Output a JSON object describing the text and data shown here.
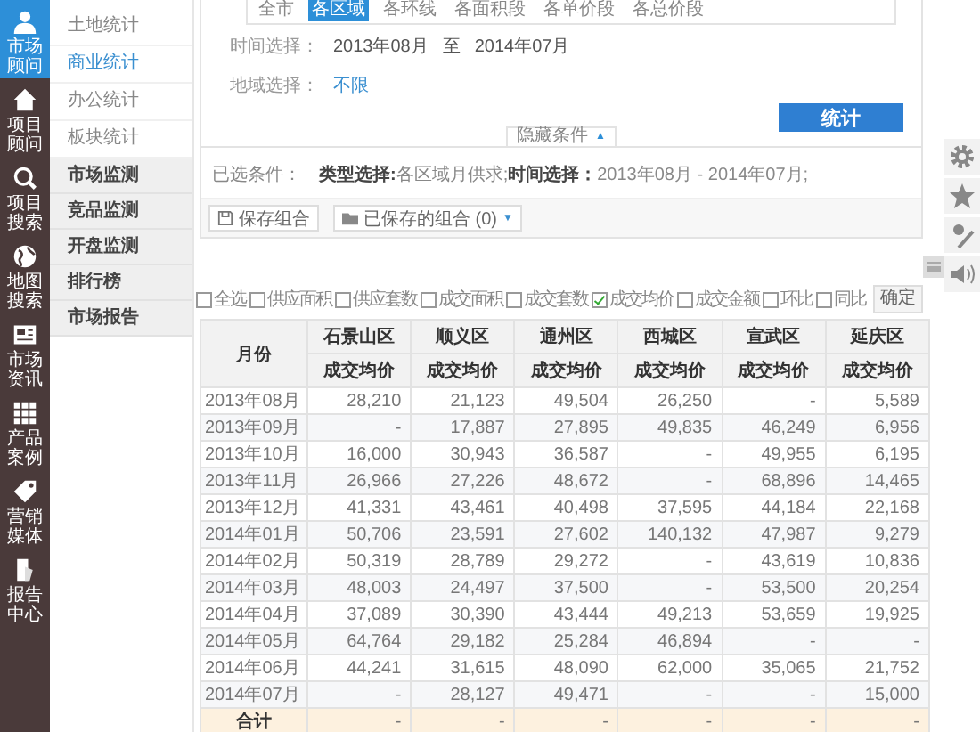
{
  "sidebar": {
    "items": [
      {
        "label": "市场顾问",
        "selected": true
      },
      {
        "label": "项目顾问",
        "selected": false
      },
      {
        "label": "项目搜索",
        "selected": false
      },
      {
        "label": "地图搜索",
        "selected": false
      },
      {
        "label": "市场资讯",
        "selected": false
      },
      {
        "label": "产品案例",
        "selected": false
      },
      {
        "label": "营销媒体",
        "selected": false
      },
      {
        "label": "报告中心",
        "selected": false
      }
    ]
  },
  "subnav": {
    "items": [
      {
        "label": "土地统计",
        "selected": false
      },
      {
        "label": "商业统计",
        "selected": true
      },
      {
        "label": "办公统计",
        "selected": false
      },
      {
        "label": "板块统计",
        "selected": false
      }
    ],
    "sections": [
      "市场监测",
      "竞品监测",
      "开盘监测",
      "排行榜",
      "市场报告"
    ]
  },
  "filters": {
    "tabs": [
      {
        "label": "全市",
        "selected": false
      },
      {
        "label": "各区域",
        "selected": true
      },
      {
        "label": "各环线",
        "selected": false
      },
      {
        "label": "各面积段",
        "selected": false
      },
      {
        "label": "各单价段",
        "selected": false
      },
      {
        "label": "各总价段",
        "selected": false
      }
    ],
    "time_label": "时间选择：",
    "time_from": "2013年08月",
    "time_sep": "至",
    "time_to": "2014年07月",
    "region_label": "地域选择：",
    "region_value": "不限",
    "stat_button": "统计",
    "toggle": "隐藏条件",
    "toggle_icon": "▲"
  },
  "selected_conditions": {
    "label": "已选条件：",
    "text": "**类型选择:**各区域月供求;**时间选择：**2013年08月 - 2014年07月;"
  },
  "save_button": "保存组合",
  "saved_button": "已保存的组合 (0)",
  "saved_caret": "▼",
  "metrics": {
    "options": [
      {
        "label": "全选",
        "checked": false
      },
      {
        "label": "供应面积",
        "checked": false
      },
      {
        "label": "供应套数",
        "checked": false
      },
      {
        "label": "成交面积",
        "checked": false
      },
      {
        "label": "成交套数",
        "checked": false
      },
      {
        "label": "成交均价",
        "checked": true
      },
      {
        "label": "成交金额",
        "checked": false
      },
      {
        "label": "环比",
        "checked": false
      },
      {
        "label": "同比",
        "checked": false
      }
    ],
    "confirm": "确定"
  },
  "table": {
    "month_header": "月份",
    "columns": [
      {
        "district": "石景山区",
        "metric": "成交均价"
      },
      {
        "district": "顺义区",
        "metric": "成交均价"
      },
      {
        "district": "通州区",
        "metric": "成交均价"
      },
      {
        "district": "西城区",
        "metric": "成交均价"
      },
      {
        "district": "宣武区",
        "metric": "成交均价"
      },
      {
        "district": "延庆区",
        "metric": "成交均价"
      }
    ],
    "rows": [
      {
        "month": "2013年08月",
        "values": [
          "28,210",
          "21,123",
          "49,504",
          "26,250",
          "-",
          "5,589"
        ]
      },
      {
        "month": "2013年09月",
        "values": [
          "-",
          "17,887",
          "27,895",
          "49,835",
          "46,249",
          "6,956"
        ]
      },
      {
        "month": "2013年10月",
        "values": [
          "16,000",
          "30,943",
          "36,587",
          "-",
          "49,955",
          "6,195"
        ]
      },
      {
        "month": "2013年11月",
        "values": [
          "26,966",
          "27,226",
          "48,672",
          "-",
          "68,896",
          "14,465"
        ]
      },
      {
        "month": "2013年12月",
        "values": [
          "41,331",
          "43,461",
          "40,498",
          "37,595",
          "44,184",
          "22,168"
        ]
      },
      {
        "month": "2014年01月",
        "values": [
          "50,706",
          "23,591",
          "27,602",
          "140,132",
          "47,987",
          "9,279"
        ]
      },
      {
        "month": "2014年02月",
        "values": [
          "50,319",
          "28,789",
          "29,272",
          "-",
          "43,619",
          "10,836"
        ]
      },
      {
        "month": "2014年03月",
        "values": [
          "48,003",
          "24,497",
          "37,500",
          "-",
          "53,500",
          "20,254"
        ]
      },
      {
        "month": "2014年04月",
        "values": [
          "37,089",
          "30,390",
          "43,444",
          "49,213",
          "53,659",
          "19,925"
        ]
      },
      {
        "month": "2014年05月",
        "values": [
          "64,764",
          "29,182",
          "25,284",
          "46,894",
          "-",
          "-"
        ]
      },
      {
        "month": "2014年06月",
        "values": [
          "44,241",
          "31,615",
          "48,090",
          "62,000",
          "35,065",
          "21,752"
        ]
      },
      {
        "month": "2014年07月",
        "values": [
          "-",
          "28,127",
          "49,471",
          "-",
          "-",
          "15,000"
        ]
      }
    ],
    "total": {
      "label": "合计",
      "values": [
        "-",
        "-",
        "-",
        "-",
        "-",
        "-"
      ]
    }
  }
}
